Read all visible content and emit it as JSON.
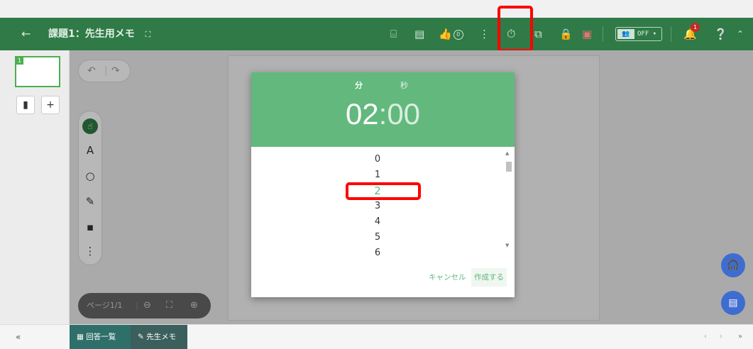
{
  "header": {
    "back_icon": "arrow-left-icon",
    "title": "課題1：先生用メモ",
    "fullscreen_icon": "expand-icon",
    "like_count": "0",
    "off_label": "OFF ▾",
    "notification_count": "1"
  },
  "page_thumb": {
    "number": "1"
  },
  "sidebar": {
    "add_label": "+"
  },
  "toolbar": {
    "text_tool_label": "A",
    "more_label": "⋮"
  },
  "page_nav": {
    "label": "ページ1/1"
  },
  "timer_dialog": {
    "minutes_label": "分",
    "seconds_label": "秒",
    "minutes_value": "02",
    "separator": ":",
    "seconds_value": "00",
    "options": [
      "0",
      "1",
      "2",
      "3",
      "4",
      "5",
      "6"
    ],
    "selected_index": 2,
    "cancel_label": "キャンセル",
    "create_label": "作成する"
  },
  "bottom_bar": {
    "collapse_label": "«",
    "tab_answers": "回答一覧",
    "tab_notes": "先生メモ",
    "prev_label": "‹",
    "next_label": "›",
    "expand_label": "»"
  },
  "colors": {
    "header_green": "#2f7a46",
    "dialog_green": "#62b87d",
    "fab_blue": "#3f6cd0",
    "highlight_red": "#ff0000"
  }
}
